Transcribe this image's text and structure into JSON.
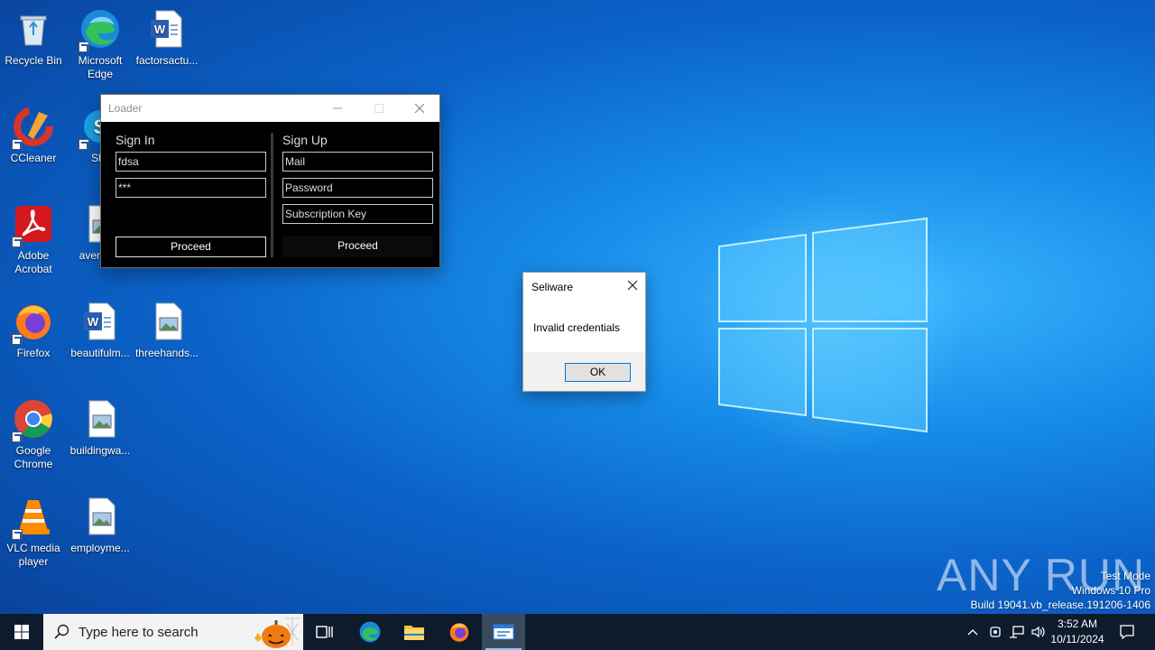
{
  "desktop": {
    "icons": [
      {
        "label": "Recycle Bin",
        "icon": "recycle-bin-icon"
      },
      {
        "label": "Microsoft Edge",
        "icon": "edge-icon"
      },
      {
        "label": "factorsactu...",
        "icon": "word-doc-icon"
      },
      {
        "label": "CCleaner",
        "icon": "ccleaner-icon"
      },
      {
        "label": "Sky",
        "icon": "skype-icon"
      },
      {
        "label": "Adobe Acrobat",
        "icon": "acrobat-icon"
      },
      {
        "label": "averag...",
        "icon": "image-file-icon"
      },
      {
        "label": "Firefox",
        "icon": "firefox-icon"
      },
      {
        "label": "beautifulm...",
        "icon": "word-doc-icon"
      },
      {
        "label": "threehands...",
        "icon": "image-file-icon"
      },
      {
        "label": "Google Chrome",
        "icon": "chrome-icon"
      },
      {
        "label": "buildingwa...",
        "icon": "image-file-icon"
      },
      {
        "label": "VLC media player",
        "icon": "vlc-icon"
      },
      {
        "label": "employme...",
        "icon": "image-file-icon"
      }
    ]
  },
  "loader": {
    "title": "Loader",
    "sign_in": {
      "heading": "Sign In",
      "username": "fdsa",
      "password": "***",
      "proceed": "Proceed"
    },
    "sign_up": {
      "heading": "Sign Up",
      "mail_placeholder": "Mail",
      "password_placeholder": "Password",
      "key_placeholder": "Subscription Key",
      "proceed": "Proceed"
    }
  },
  "msgbox": {
    "title": "Seliware",
    "message": "Invalid credentials",
    "ok": "OK"
  },
  "watermark": {
    "brand": "ANY RUN",
    "line1": "Test Mode",
    "line2": "Windows 10 Pro",
    "line3": "Build 19041.vb_release.191206-1406"
  },
  "taskbar": {
    "search_placeholder": "Type here to search",
    "time": "3:52 AM",
    "date": "10/11/2024"
  },
  "colors": {
    "accent": "#0078d7",
    "taskbar": "#0e1b2c",
    "desktop": "#0b63c9"
  }
}
